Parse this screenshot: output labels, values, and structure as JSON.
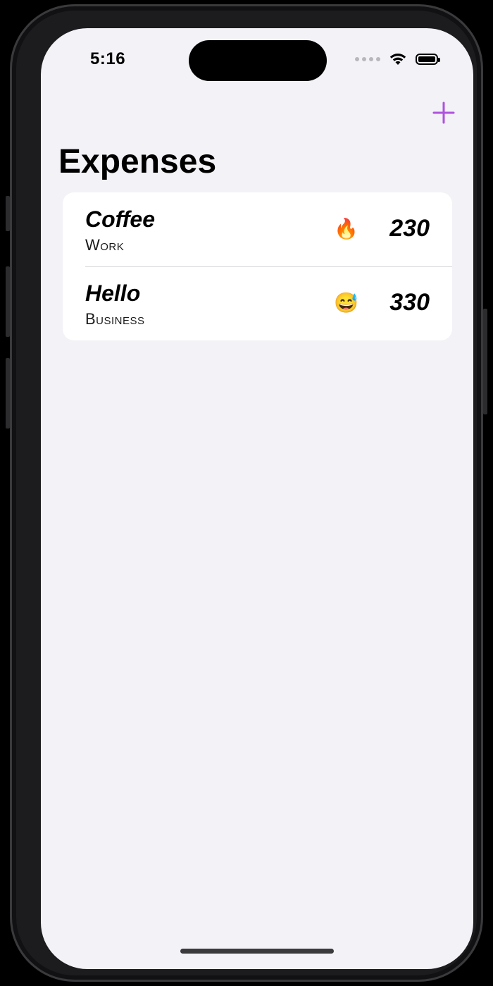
{
  "status_bar": {
    "time": "5:16"
  },
  "nav": {
    "add_icon": "plus-icon",
    "accent_color": "#af52de"
  },
  "page": {
    "title": "Expenses"
  },
  "expenses": [
    {
      "name": "Coffee",
      "category": "Work",
      "emoji": "🔥",
      "amount": "230"
    },
    {
      "name": "Hello",
      "category": "Business",
      "emoji": "😅",
      "amount": "330"
    }
  ]
}
